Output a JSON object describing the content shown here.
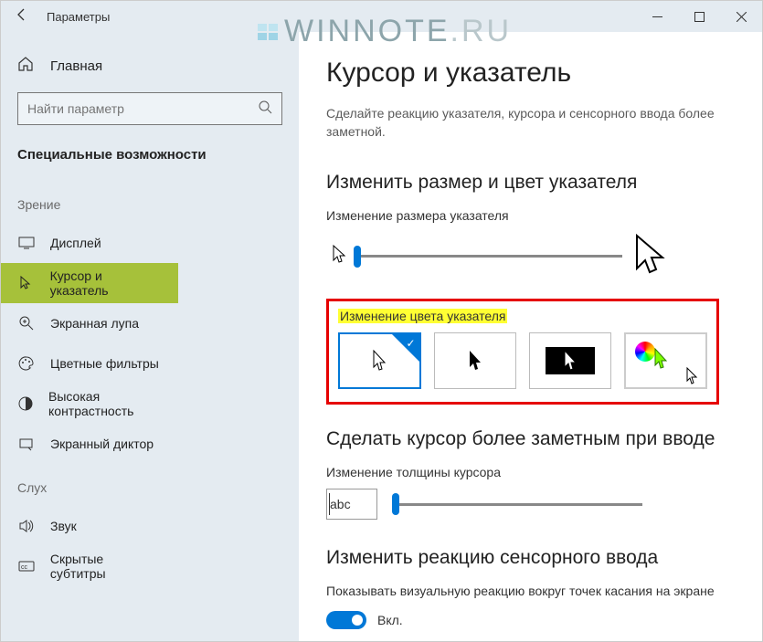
{
  "window": {
    "title": "Параметры"
  },
  "watermark": {
    "text": "WINNOTE",
    "suffix": ".RU"
  },
  "sidebar": {
    "home": "Главная",
    "search_placeholder": "Найти параметр",
    "category": "Специальные возможности",
    "group_vision": "Зрение",
    "group_hearing": "Слух",
    "items_vision": [
      {
        "label": "Дисплей",
        "icon": "display-icon"
      },
      {
        "label": "Курсор и указатель",
        "icon": "cursor-icon",
        "selected": true
      },
      {
        "label": "Экранная лупа",
        "icon": "magnifier-plus-icon"
      },
      {
        "label": "Цветные фильтры",
        "icon": "palette-icon"
      },
      {
        "label": "Высокая контрастность",
        "icon": "contrast-icon"
      },
      {
        "label": "Экранный диктор",
        "icon": "narrator-icon"
      }
    ],
    "items_hearing": [
      {
        "label": "Звук",
        "icon": "sound-icon"
      },
      {
        "label": "Скрытые субтитры",
        "icon": "cc-icon"
      }
    ]
  },
  "main": {
    "title": "Курсор и указатель",
    "description": "Сделайте реакцию указателя, курсора и сенсорного ввода более заметной.",
    "section_size": "Изменить размер и цвет указателя",
    "label_size": "Изменение размера указателя",
    "label_color": "Изменение цвета указателя",
    "color_tiles": [
      {
        "name": "white-cursor-tile",
        "selected": true
      },
      {
        "name": "black-cursor-tile"
      },
      {
        "name": "inverted-cursor-tile"
      },
      {
        "name": "custom-color-cursor-tile"
      }
    ],
    "section_thickness": "Сделать курсор более заметным при вводе",
    "label_thickness": "Изменение толщины курсора",
    "abc_sample": "abc",
    "section_touch": "Изменить реакцию сенсорного ввода",
    "label_touch": "Показывать визуальную реакцию вокруг точек касания на экране",
    "toggle_state": "Вкл."
  }
}
